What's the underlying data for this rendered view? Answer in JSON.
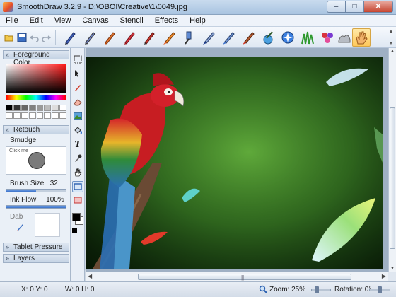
{
  "window": {
    "title": "SmoothDraw 3.2.9 - D:\\OBOI\\Creative\\1\\0049.jpg",
    "minimize_glyph": "–",
    "maximize_glyph": "□",
    "close_glyph": "✕"
  },
  "menu": [
    "File",
    "Edit",
    "View",
    "Canvas",
    "Stencil",
    "Effects",
    "Help"
  ],
  "toolbar": {
    "quick_actions": [
      "open-folder-icon",
      "save-icon",
      "undo-icon",
      "redo-icon"
    ],
    "brushes": [
      "pen-icon",
      "pencil-icon",
      "crayon-icon",
      "chalk-icon",
      "marker-icon",
      "watercolor-brush-icon",
      "airbrush-icon",
      "paintbrush-icon",
      "fill-brush-icon",
      "smudge-brush-icon",
      "eraser-brush-icon",
      "sparkle-icon",
      "grass-icon",
      "flowers-icon",
      "image-hose-icon",
      "hand-icon"
    ],
    "active_brush_index": 15
  },
  "panels": {
    "foreground_color": "Foreground Color",
    "retouch": "Retouch",
    "tablet_pressure": "Tablet Pressure",
    "layers": "Layers"
  },
  "color": {
    "current": "#ff1a1a",
    "palette": [
      "#000000",
      "#333333",
      "#666666",
      "#808080",
      "#999999",
      "#bbbbbb",
      "#dddddd",
      "#ffffff",
      "#ffffff",
      "#ffffff",
      "#ffffff",
      "#ffffff",
      "#ffffff",
      "#ffffff",
      "#ffffff",
      "#ffffff"
    ]
  },
  "retouch": {
    "tool_name": "Smudge",
    "preview_hint": "Click me",
    "brush_size_label": "Brush Size",
    "brush_size_value": "32",
    "brush_size_fraction": 0.5,
    "ink_flow_label": "Ink Flow",
    "ink_flow_value": "100%",
    "ink_flow_fraction": 1.0,
    "dab_label": "Dab"
  },
  "tools": [
    "select-icon",
    "move-icon",
    "brush-tool-icon",
    "eraser-icon",
    "image-tool-icon",
    "fill-icon",
    "text-icon",
    "eyedropper-icon",
    "hand-tool-icon",
    "rectangle-icon",
    "rectangle-fill-icon"
  ],
  "active_tool_index": 9,
  "scrollbars": {
    "up": "▲",
    "down": "▼",
    "left": "◀",
    "right": "▶",
    "grip": "|||"
  },
  "status": {
    "cursor": "X: 0 Y: 0",
    "selection": "W: 0 H: 0",
    "zoom": "Zoom: 25%",
    "zoom_fraction": 0.25,
    "rotation": "Rotation: 0°",
    "rotation_fraction": 0.5
  }
}
